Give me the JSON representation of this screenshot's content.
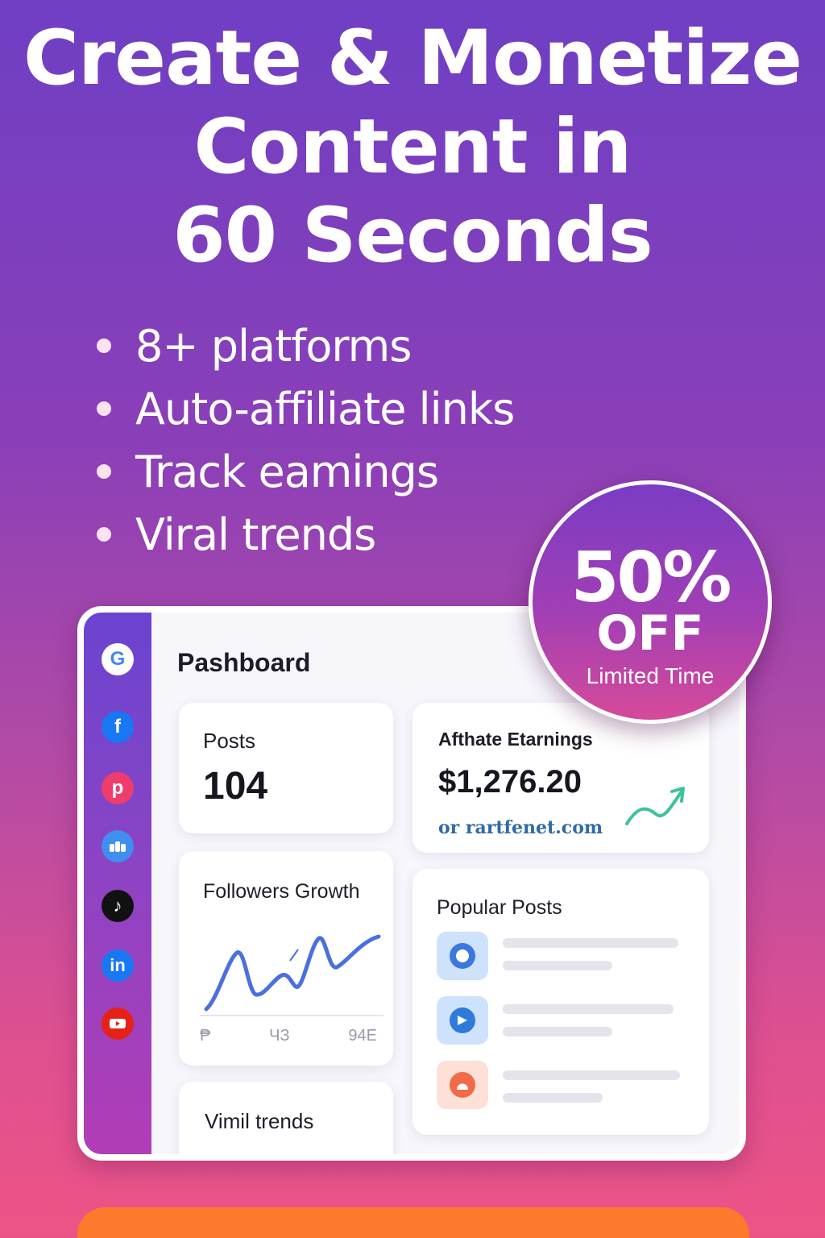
{
  "headline": {
    "line1": "Create & Monetize",
    "line2": "Content in",
    "line3": "60 Seconds"
  },
  "features": [
    "8+ platforms",
    "Auto-affiliate links",
    "Track eamings",
    "Viral trends"
  ],
  "badge": {
    "percent": "50%",
    "off": "OFF",
    "note": "Limited Time"
  },
  "dashboard": {
    "title": "Pashboard",
    "platform_icons": [
      "google-icon",
      "facebook-icon",
      "pinterest-icon",
      "cloud-icon",
      "tiktok-icon",
      "linkedin-icon",
      "youtube-icon"
    ],
    "posts": {
      "label": "Posts",
      "value": "104"
    },
    "earnings": {
      "label": "Afthate Etarnings",
      "amount": "$1,276.20",
      "site": "or rartfenet.com"
    },
    "followers": {
      "label": "Followers Growth",
      "axis": [
        "₱",
        "ЧЗ",
        "94E"
      ]
    },
    "popular": {
      "label": "Popular Posts"
    },
    "trends": {
      "label": "Vimil trends"
    }
  },
  "colors": {
    "accent_orange": "#fb7a2c",
    "chart_blue": "#4b6fe0",
    "trend_green": "#3dc29a"
  }
}
